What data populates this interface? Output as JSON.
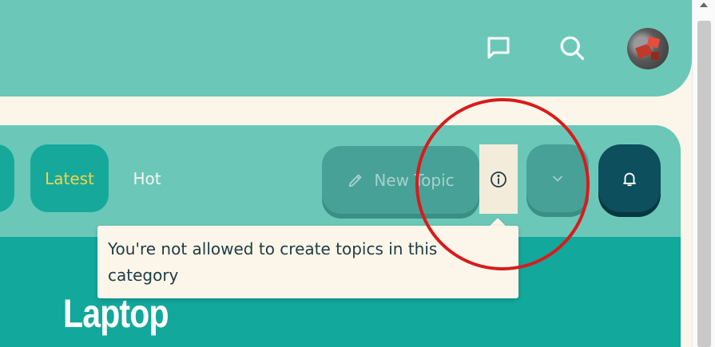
{
  "header": {
    "chat_icon": "chat-bubble-icon",
    "search_icon": "search-icon",
    "avatar": "user-avatar"
  },
  "nav": {
    "tabs": [
      {
        "label": "Latest",
        "active": true
      },
      {
        "label": "Hot",
        "active": false
      }
    ]
  },
  "actions": {
    "new_topic_label": "New Topic",
    "new_topic_icon": "pencil-icon",
    "info_icon": "info-icon",
    "dropdown_icon": "chevron-down-icon",
    "notification_icon": "bell-icon"
  },
  "tooltip": {
    "text": "You're not allowed to create topics in this category"
  },
  "category": {
    "title": "Laptop"
  },
  "colors": {
    "header_bg": "#6bc8b8",
    "page_bg": "#fbf6e9",
    "teal_dark": "#12a89b",
    "latest_text": "#f2d44b",
    "bell_bg": "#0d4f5c",
    "annotation_circle": "#d81b1b"
  }
}
